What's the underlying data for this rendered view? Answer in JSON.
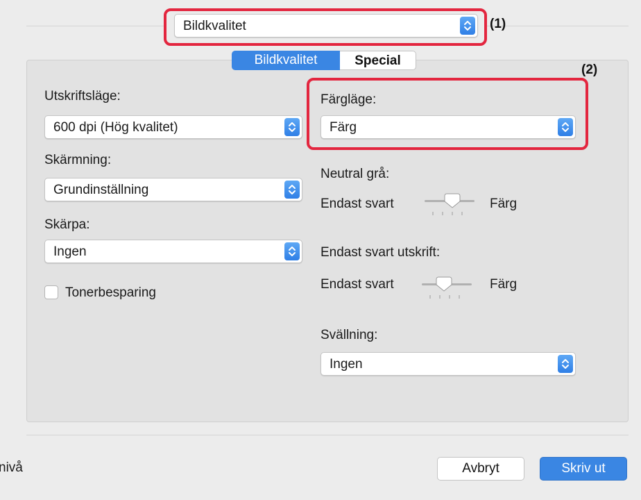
{
  "top_popup": {
    "value": "Bildkvalitet"
  },
  "callouts": {
    "one": "(1)",
    "two": "(2)"
  },
  "tabs": [
    {
      "label": "Bildkvalitet",
      "active": true
    },
    {
      "label": "Special",
      "active": false
    }
  ],
  "left": {
    "print_mode_label": "Utskriftsläge:",
    "print_mode_value": "600 dpi (Hög kvalitet)",
    "screening_label": "Skärmning:",
    "screening_value": "Grundinställning",
    "sharpness_label": "Skärpa:",
    "sharpness_value": "Ingen",
    "toner_save_label": "Tonerbesparing",
    "toner_save_checked": false
  },
  "right": {
    "color_mode_label": "Färgläge:",
    "color_mode_value": "Färg",
    "neutral_gray_label": "Neutral grå:",
    "neutral_gray_left": "Endast svart",
    "neutral_gray_right": "Färg",
    "black_only_label": "Endast svart utskrift:",
    "black_only_left": "Endast svart",
    "black_only_right": "Färg",
    "swelling_label": "Svällning:",
    "swelling_value": "Ingen"
  },
  "footer": {
    "left_text": "nivå",
    "cancel_label": "Avbryt",
    "print_label": "Skriv ut"
  },
  "colors": {
    "accent": "#3a86e3",
    "callout": "#e3263f"
  }
}
